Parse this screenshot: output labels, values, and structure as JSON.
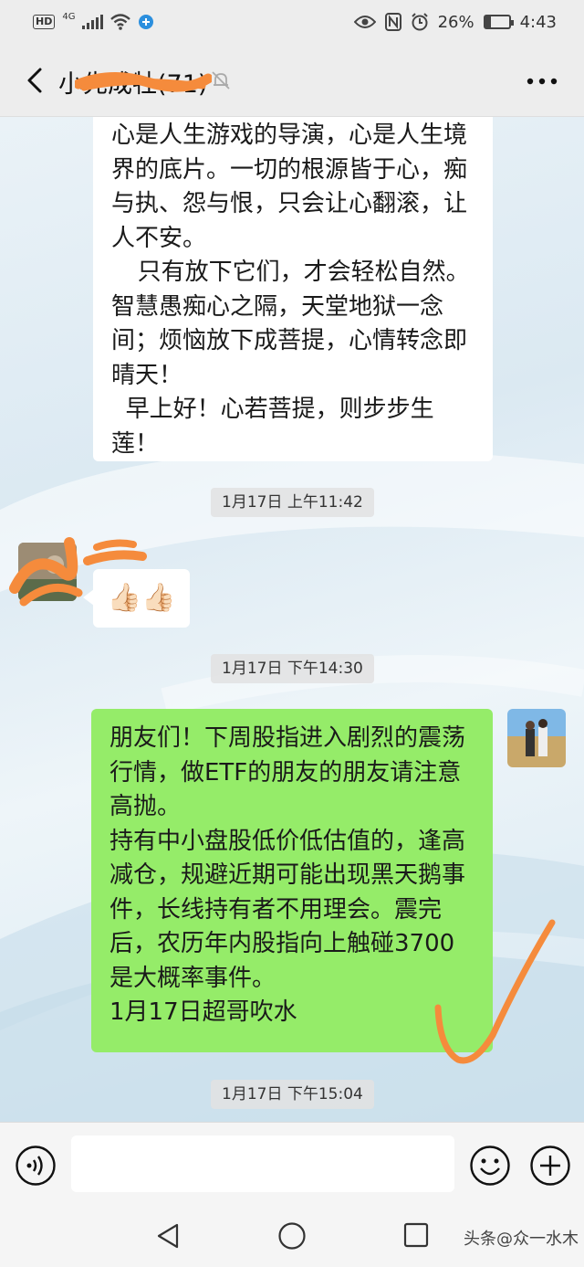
{
  "status_bar": {
    "hd_label": "HD",
    "network_label": "4G",
    "battery_percent": "26%",
    "battery_level": 0.26,
    "time": "4:43",
    "icons": [
      "hd-icon",
      "signal-icon",
      "wifi-icon",
      "browser-badge-icon",
      "eye-icon",
      "nfc-icon",
      "alarm-icon",
      "battery-icon"
    ]
  },
  "header": {
    "title": "小先成牡(71)",
    "icons": [
      "back-icon",
      "mute-bell-icon",
      "more-icon"
    ]
  },
  "messages": [
    {
      "type": "incoming_text",
      "paragraphs": [
        "心是人生游戏的导演，心是人生境界的底片。一切的根源皆于心，痴与执、怨与恨，只会让心翻滚，让人不安。",
        "只有放下它们，才会轻松自然。智慧愚痴心之隔，天堂地狱一念间；烦恼放下成菩提，心情转念即晴天！",
        "早上好！心若菩提，则步步生莲！"
      ]
    },
    {
      "type": "timestamp",
      "text": "1月17日 上午11:42"
    },
    {
      "type": "incoming_emoji",
      "emoji": "👍🏻👍🏻"
    },
    {
      "type": "timestamp",
      "text": "1月17日 下午14:30"
    },
    {
      "type": "outgoing_text",
      "paragraphs": [
        "朋友们！下周股指进入剧烈的震荡行情，做ETF的朋友的朋友请注意高抛。",
        "持有中小盘股低价低估值的，逢高减仓，规避近期可能出现黑天鹅事件，长线持有者不用理会。震完后，农历年内股指向上触碰3700是大概率事件。",
        "1月17日超哥吹水"
      ]
    },
    {
      "type": "timestamp",
      "text": "1月17日 下午15:04"
    }
  ],
  "input_bar": {
    "placeholder": "",
    "icons": [
      "voice-icon",
      "emoji-icon",
      "plus-icon"
    ]
  },
  "nav_bar": {
    "icons": [
      "nav-back-icon",
      "nav-home-icon",
      "nav-recent-icon"
    ],
    "watermark": "头条@众一水木"
  },
  "colors": {
    "outgoing_bubble": "#95ec69",
    "incoming_bubble": "#ffffff",
    "bar_background": "#ededed",
    "scribble": "#f58b3c"
  }
}
